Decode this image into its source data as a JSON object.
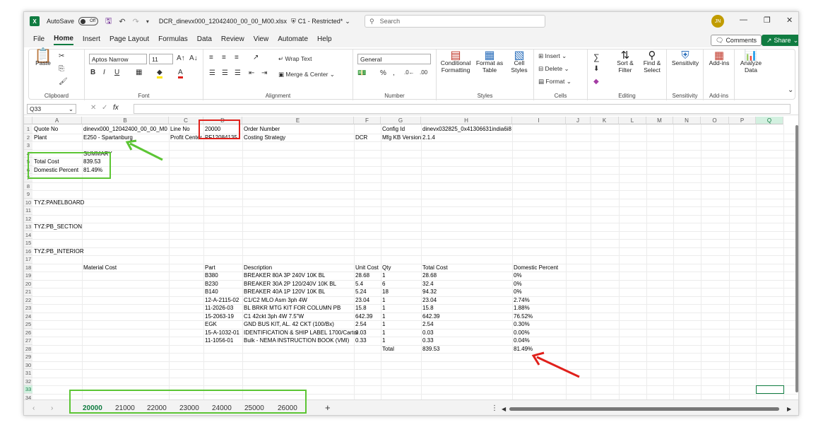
{
  "title": {
    "autosave": "AutoSave",
    "toggle": "Off",
    "filename": "DCR_dinevx000_12042400_00_00_M00.xlsx",
    "sensitivity": "C1 - Restricted*",
    "search": "Search",
    "user": "JN"
  },
  "menu": [
    "File",
    "Home",
    "Insert",
    "Page Layout",
    "Formulas",
    "Data",
    "Review",
    "View",
    "Automate",
    "Help"
  ],
  "buttons": {
    "comments": "Comments",
    "share": "Share"
  },
  "ribbon": {
    "clipboard": {
      "label": "Clipboard",
      "paste": "Paste"
    },
    "font": {
      "label": "Font",
      "name": "Aptos Narrow",
      "size": "11"
    },
    "alignment": {
      "label": "Alignment",
      "wrap": "Wrap Text",
      "merge": "Merge & Center"
    },
    "number": {
      "label": "Number",
      "format": "General"
    },
    "styles": {
      "label": "Styles",
      "cond": "Conditional Formatting",
      "table": "Format as Table",
      "cell": "Cell Styles"
    },
    "cells": {
      "label": "Cells",
      "insert": "Insert",
      "delete": "Delete",
      "format": "Format"
    },
    "editing": {
      "label": "Editing",
      "sort": "Sort & Filter",
      "find": "Find & Select"
    },
    "sensitivity": {
      "label": "Sensitivity",
      "btn": "Sensitivity"
    },
    "addins": {
      "label": "Add-ins",
      "btn": "Add-ins"
    },
    "analyze": {
      "btn": "Analyze Data"
    }
  },
  "namebox": "Q33",
  "columns": [
    "A",
    "B",
    "C",
    "D",
    "E",
    "F",
    "G",
    "H",
    "I",
    "J",
    "K",
    "L",
    "M",
    "N",
    "O",
    "P",
    "Q"
  ],
  "rows": [
    "1",
    "2",
    "3",
    "4",
    "5",
    "6",
    "7",
    "8",
    "9",
    "10",
    "11",
    "12",
    "13",
    "14",
    "15",
    "16",
    "17",
    "18",
    "19",
    "20",
    "21",
    "22",
    "23",
    "24",
    "25",
    "26",
    "27",
    "28",
    "29",
    "30",
    "31",
    "32",
    "33",
    "34"
  ],
  "header": {
    "a1": "Quote No",
    "b1": "dinevx000_12042400_00_00_M0",
    "c1": "Line No",
    "d1": "20000",
    "e1": "Order Number",
    "g1": "Config Id",
    "h1": "dinevx032825_0x41306631india6i8",
    "a2": "Plant",
    "b2": "E250 - Spartanburg",
    "c2": "Profit Center",
    "d2": "PF12084135",
    "e2": "Costing Strategy",
    "f2": "DCR",
    "g2": "Mfg KB Version",
    "h2": "2.1.4"
  },
  "summary": {
    "title": "SUMMARY",
    "total_label": "Total Cost",
    "total": "839.53",
    "dom_label": "Domestic Percent",
    "dom": "81.49%"
  },
  "sections": [
    "TYZ:PANELBOARD",
    "TYZ:PB_SECTION",
    "TYZ:PB_INTERIOR"
  ],
  "material": {
    "label": "Material Cost",
    "headers": [
      "Part",
      "Description",
      "Unit Cost",
      "Qty",
      "Total Cost",
      "Domestic Percent"
    ],
    "rows": [
      [
        "B380",
        "BREAKER 80A 3P 240V 10K BL",
        "28.68",
        "1",
        "28.68",
        "0%"
      ],
      [
        "B230",
        "BREAKER 30A 2P 120/240V 10K BL",
        "5.4",
        "6",
        "32.4",
        "0%"
      ],
      [
        "B140",
        "BREAKER 40A 1P 120V 10K BL",
        "5.24",
        "18",
        "94.32",
        "0%"
      ],
      [
        "12-A-2115-02",
        "C1/C2 MLO Asm 3ph 4W",
        "23.04",
        "1",
        "23.04",
        "2.74%"
      ],
      [
        "11-2026-03",
        "BL BRKR MTG KIT FOR COLUMN PB",
        "15.8",
        "1",
        "15.8",
        "1.88%"
      ],
      [
        "15-2063-19",
        "C1 42ckt 3ph 4W 7.5\"W",
        "642.39",
        "1",
        "642.39",
        "76.52%"
      ],
      [
        "EGK",
        "GND BUS KIT, AL. 42 CKT (100/Bx)",
        "2.54",
        "1",
        "2.54",
        "0.30%"
      ],
      [
        "15-A-1032-01",
        "IDENTIFICATION & SHIP LABEL 1700/Cartor",
        "0.03",
        "1",
        "0.03",
        "0.00%"
      ],
      [
        "11-1056-01",
        "Bulk - NEMA INSTRUCTION BOOK (VMI)",
        "0.33",
        "1",
        "0.33",
        "0.04%"
      ]
    ],
    "total_label": "Total",
    "total_cost": "839.53",
    "total_dom": "81.49%"
  },
  "sheets": [
    "20000",
    "21000",
    "22000",
    "23000",
    "24000",
    "25000",
    "26000"
  ],
  "colors": {
    "accent": "#107c41",
    "red": "#e0201b",
    "green": "#5cc534"
  }
}
